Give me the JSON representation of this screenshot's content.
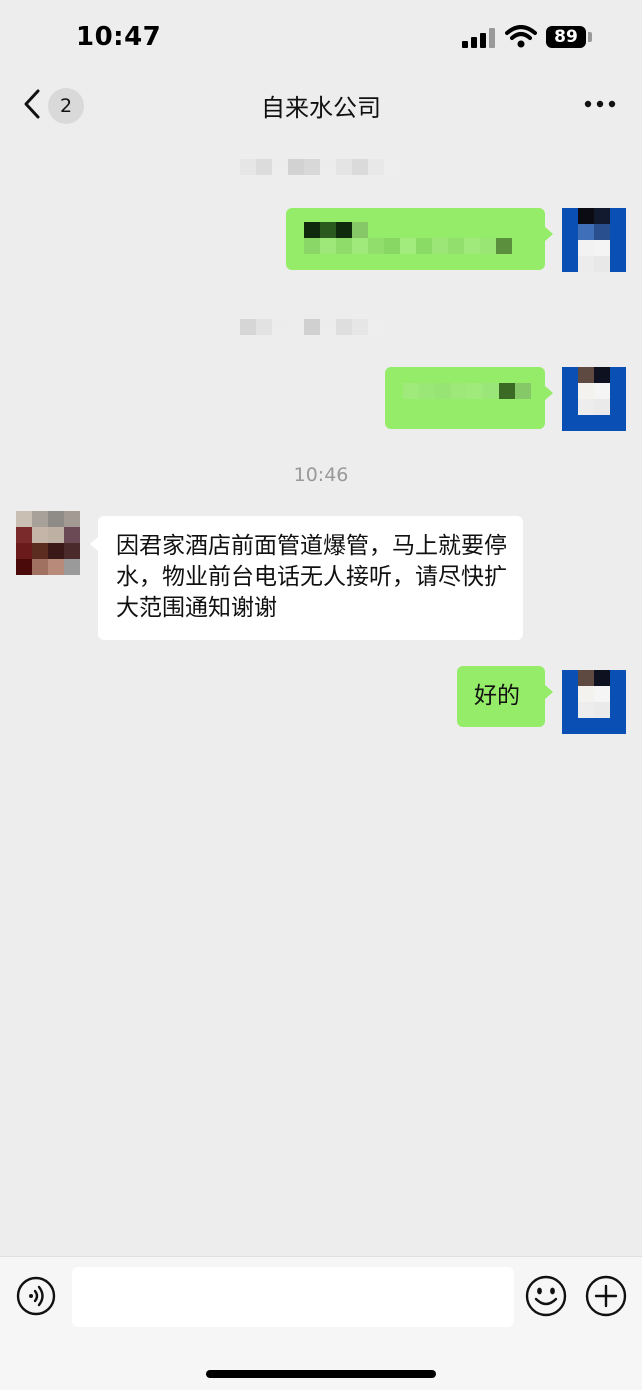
{
  "status_bar": {
    "time": "10:47",
    "battery": "89"
  },
  "nav": {
    "back_count": "2",
    "title": "自来水公司"
  },
  "chat": {
    "timestamp": "10:46",
    "incoming_message": "因君家酒店前面管道爆管，马上就要停水，物业前台电话无人接听，请尽快扩大范围通知谢谢",
    "outgoing_reply": "好的"
  },
  "input": {
    "placeholder": ""
  },
  "colors": {
    "sent_bubble": "#95ec69",
    "received_bubble": "#ffffff",
    "background": "#ededed"
  },
  "icons": [
    "chevron-left-icon",
    "more-icon",
    "voice-icon",
    "emoji-icon",
    "plus-icon",
    "wifi-icon",
    "signal-icon",
    "battery-icon"
  ]
}
